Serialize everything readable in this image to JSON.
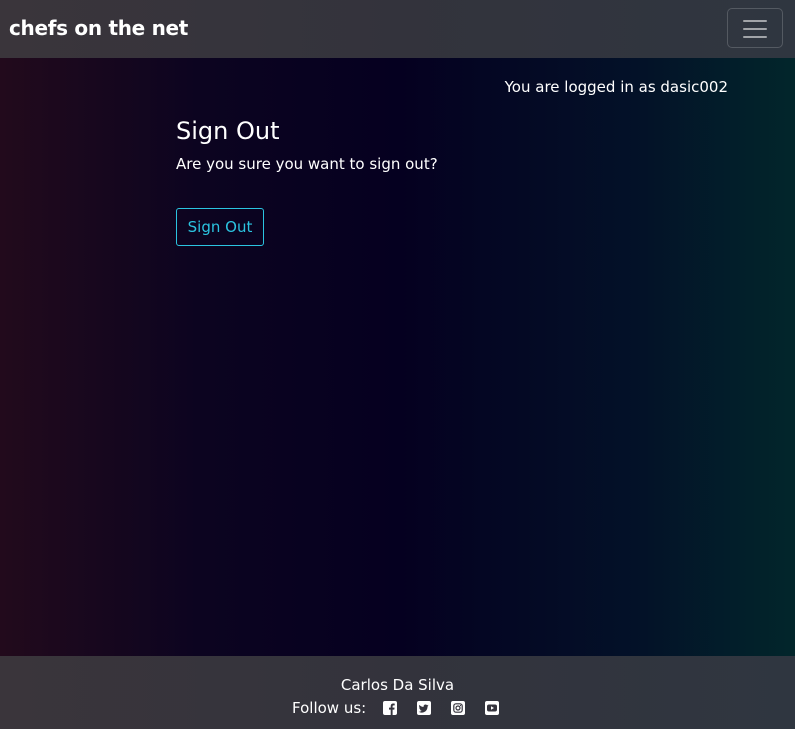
{
  "navbar": {
    "brand": "chefs on the net",
    "toggler_icon": "hamburger-menu-icon"
  },
  "main": {
    "login_status": "You are logged in as dasic002",
    "title": "Sign Out",
    "prompt": "Are you sure you want to sign out?",
    "signout_button_label": "Sign Out"
  },
  "footer": {
    "author": "Carlos Da Silva",
    "follow_label": "Follow us:",
    "social_icons": [
      "facebook-icon",
      "twitter-icon",
      "instagram-icon",
      "youtube-icon"
    ]
  },
  "colors": {
    "accent": "#2bc4e0",
    "text": "#ffffff",
    "bar_background": "#35343d"
  }
}
